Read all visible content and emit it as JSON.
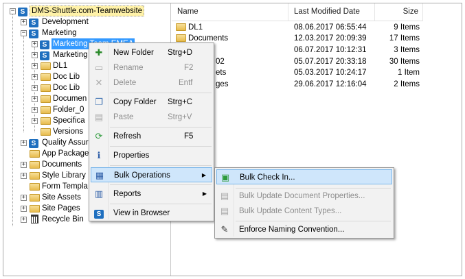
{
  "tree": {
    "items": [
      {
        "label": "DMS-Shuttle.com-Teamwebsite",
        "icon": "sharepoint-icon"
      },
      {
        "label": "Development",
        "icon": "sharepoint-icon"
      },
      {
        "label": "Marketing",
        "icon": "sharepoint-icon"
      },
      {
        "label": "Marketing Team EMEA",
        "icon": "sharepoint-icon"
      },
      {
        "label": "Marketing",
        "icon": "sharepoint-icon"
      },
      {
        "label": "DL1",
        "icon": "folder-icon"
      },
      {
        "label": "Doc Lib",
        "icon": "folder-icon"
      },
      {
        "label": "Doc Lib",
        "icon": "folder-icon"
      },
      {
        "label": "Documen",
        "icon": "folder-icon"
      },
      {
        "label": "Folder_0",
        "icon": "folder-icon"
      },
      {
        "label": "Specifica",
        "icon": "folder-icon"
      },
      {
        "label": "Versions",
        "icon": "folder-icon"
      },
      {
        "label": "Quality Assur",
        "icon": "sharepoint-icon"
      },
      {
        "label": "App Package",
        "icon": "folder-icon"
      },
      {
        "label": "Documents",
        "icon": "folder-icon"
      },
      {
        "label": "Style Library",
        "icon": "folder-icon"
      },
      {
        "label": "Form Templa",
        "icon": "folder-icon"
      },
      {
        "label": "Site Assets",
        "icon": "folder-icon"
      },
      {
        "label": "Site Pages",
        "icon": "folder-icon"
      },
      {
        "label": "Recycle Bin",
        "icon": "recycle-bin-icon"
      }
    ]
  },
  "list": {
    "columns": {
      "name": "Name",
      "modified": "Last Modified Date",
      "size": "Size"
    },
    "rows": [
      {
        "name": "DL1",
        "modified": "08.06.2017 06:55:44",
        "size": "9 Items"
      },
      {
        "name": "Documents",
        "modified": "12.03.2017 20:09:39",
        "size": "17 Items"
      },
      {
        "name": "",
        "modified": "06.07.2017 10:12:31",
        "size": "3 Items"
      },
      {
        "name": "02",
        "modified": "05.07.2017 20:33:18",
        "size": "30 Items"
      },
      {
        "name": "ets",
        "modified": "05.03.2017 10:24:17",
        "size": "1 Item"
      },
      {
        "name": "ges",
        "modified": "29.06.2017 12:16:04",
        "size": "2 Items"
      }
    ]
  },
  "context_menu": {
    "new_folder": {
      "label": "New Folder",
      "key": "Strg+D"
    },
    "rename": {
      "label": "Rename",
      "key": "F2"
    },
    "delete": {
      "label": "Delete",
      "key": "Entf"
    },
    "copy_folder": {
      "label": "Copy Folder",
      "key": "Strg+C"
    },
    "paste": {
      "label": "Paste",
      "key": "Strg+V"
    },
    "refresh": {
      "label": "Refresh",
      "key": "F5"
    },
    "properties": {
      "label": "Properties"
    },
    "bulk_operations": {
      "label": "Bulk Operations"
    },
    "reports": {
      "label": "Reports"
    },
    "view_in_browser": {
      "label": "View in Browser"
    }
  },
  "submenu": {
    "bulk_check_in": {
      "label": "Bulk Check In..."
    },
    "bulk_update_doc_props": {
      "label": "Bulk Update Document Properties..."
    },
    "bulk_update_content_types": {
      "label": "Bulk Update Content Types..."
    },
    "enforce_naming": {
      "label": "Enforce Naming Convention..."
    }
  },
  "colors": {
    "selection": "#3399ff",
    "menu_highlight": "#cfe6fb",
    "root_highlight": "#fff2a8"
  }
}
